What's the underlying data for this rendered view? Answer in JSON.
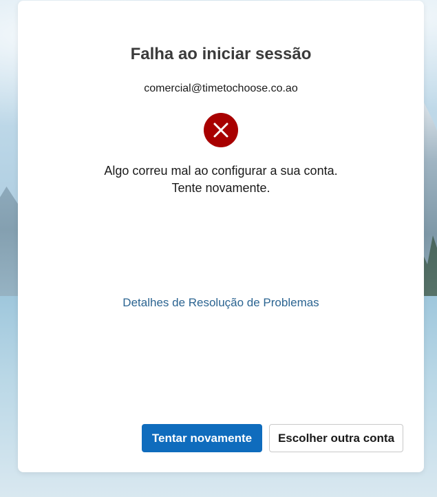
{
  "dialog": {
    "title": "Falha ao iniciar sessão",
    "account_email": "comercial@timetochoose.co.ao",
    "error_icon": "error-circle-x-icon",
    "message_line1": "Algo correu mal ao configurar a sua conta.",
    "message_line2": "Tente novamente.",
    "details_link": "Detalhes de Resolução de Problemas",
    "primary_button": "Tentar novamente",
    "secondary_button": "Escolher outra conta"
  },
  "colors": {
    "primary_button_bg": "#0f6cbd",
    "error_icon_bg": "#a80000",
    "link": "#2b6491"
  }
}
